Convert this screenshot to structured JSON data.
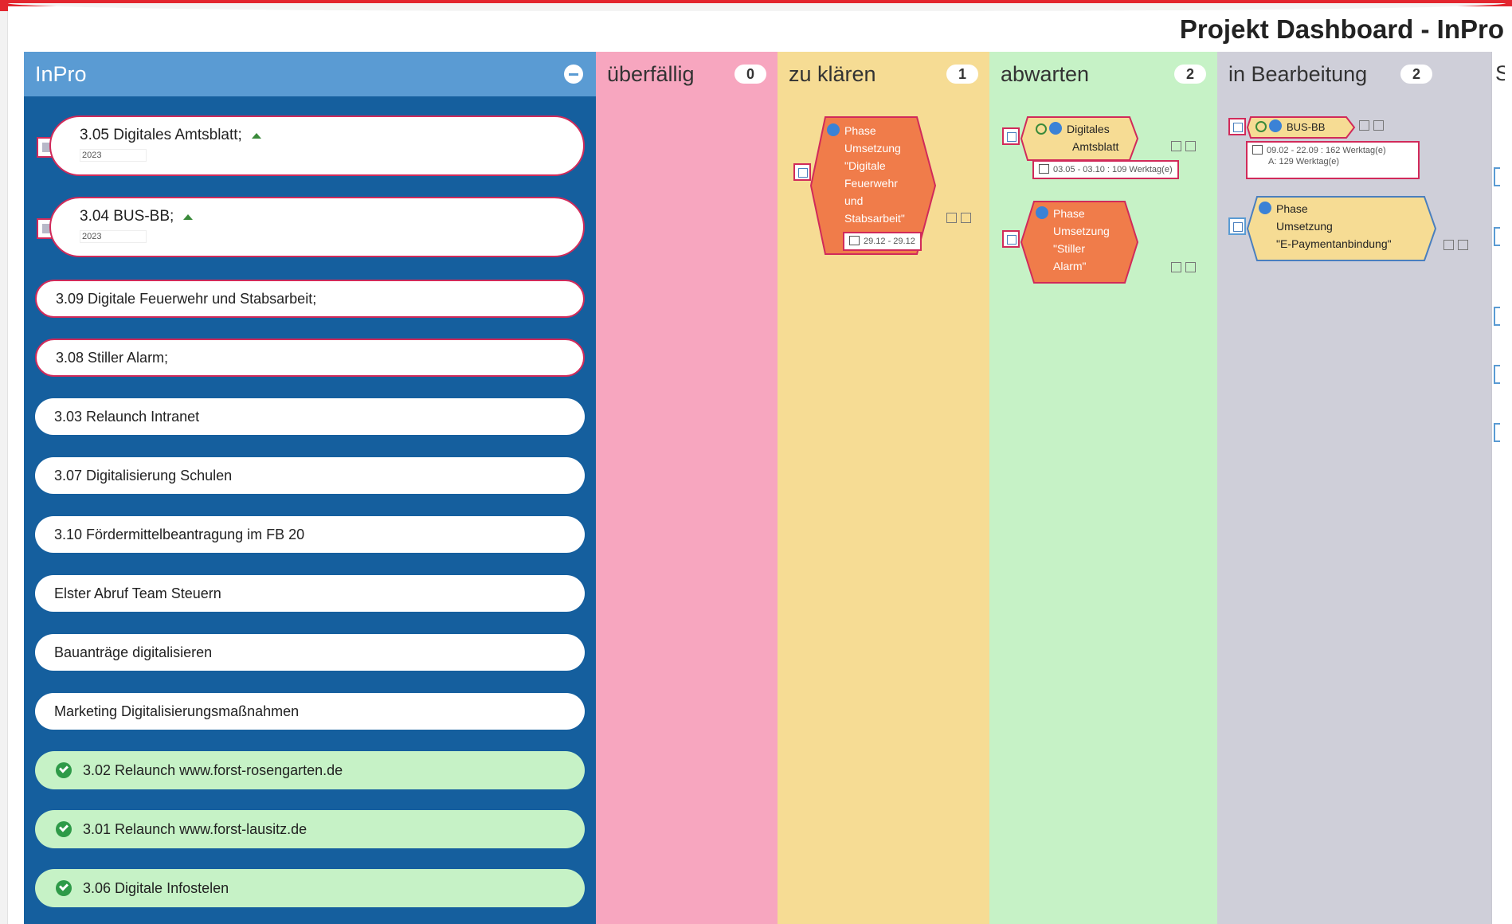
{
  "dashboard": {
    "title": "Projekt Dashboard - InPro"
  },
  "columns": {
    "inpro": {
      "title": "InPro"
    },
    "ueberfaellig": {
      "title": "überfällig",
      "count": "0"
    },
    "zu_klaeren": {
      "title": "zu klären",
      "count": "1"
    },
    "abwarten": {
      "title": "abwarten",
      "count": "2"
    },
    "in_bearbeitung": {
      "title": "in Bearbeitung",
      "count": "2"
    },
    "next": {
      "title_fragment": "S"
    }
  },
  "projects": [
    {
      "title": "3.05 Digitales Amtsblatt;",
      "year": "2023"
    },
    {
      "title": "3.04 BUS-BB;",
      "year": "2023"
    },
    {
      "title": "3.09 Digitale Feuerwehr und Stabsarbeit;"
    },
    {
      "title": "3.08 Stiller Alarm;"
    },
    {
      "title": "3.03 Relaunch Intranet"
    },
    {
      "title": "3.07 Digitalisierung Schulen"
    },
    {
      "title": "3.10 Fördermittelbeantragung im FB 20"
    },
    {
      "title": "Elster Abruf Team Steuern"
    },
    {
      "title": "Bauanträge digitalisieren"
    },
    {
      "title": "Marketing Digitalisierungsmaßnahmen"
    },
    {
      "title": "3.02 Relaunch www.forst-rosengarten.de",
      "status": "done"
    },
    {
      "title": "3.01 Relaunch www.forst-lausitz.de",
      "status": "done"
    },
    {
      "title": "3.06 Digitale Infostelen",
      "status": "done"
    }
  ],
  "tasks": {
    "feuerwehr": {
      "lines": [
        "Phase",
        "Umsetzung",
        "\"Digitale",
        "Feuerwehr",
        "und",
        "Stabsarbeit\""
      ],
      "date": "29.12 - 29.12"
    },
    "amtsblatt": {
      "lines": [
        "Digitales",
        "Amtsblatt"
      ],
      "date": "03.05 - 03.10 : 109 Werktag(e)"
    },
    "stiller_alarm": {
      "lines": [
        "Phase",
        "Umsetzung",
        "\"Stiller",
        "Alarm\""
      ]
    },
    "bus_bb": {
      "title": "BUS-BB",
      "date": "09.02 - 22.09 : 162 Werktag(e)",
      "remaining": "A: 129 Werktag(e)"
    },
    "epayment": {
      "lines": [
        "Phase",
        "Umsetzung",
        "\"E-Paymentanbindung\""
      ]
    }
  },
  "colors": {
    "brand_red": "#e3262f",
    "inpro_column": "#155f9e",
    "inpro_header": "#5a9bd3",
    "ueberfaellig": "#f7a6bf",
    "zu_klaeren": "#f6dc94",
    "abwarten": "#c6f2c6",
    "in_bearbeitung": "#cfcfd9",
    "task_orange": "#f07c4a",
    "task_yellow": "#f6dc94"
  }
}
